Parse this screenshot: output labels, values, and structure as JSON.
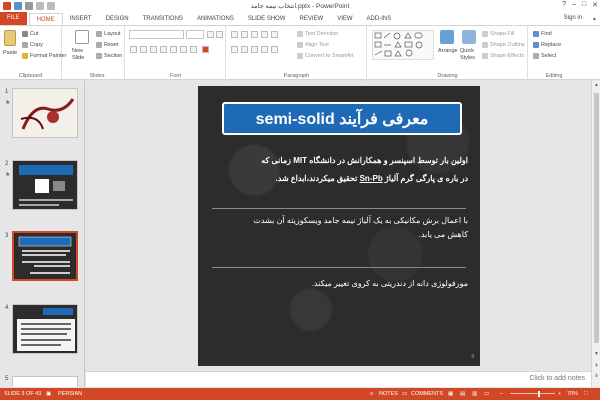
{
  "window": {
    "title": "انتخاب نيمه جامد.pptx - PowerPoint",
    "help": "?",
    "controls": [
      "–",
      "□",
      "✕"
    ],
    "signin": "Sign in"
  },
  "tabs": [
    "FILE",
    "HOME",
    "INSERT",
    "DESIGN",
    "TRANSITIONS",
    "ANIMATIONS",
    "SLIDE SHOW",
    "REVIEW",
    "VIEW",
    "ADD-INS"
  ],
  "ribbon": {
    "clipboard": {
      "label": "Clipboard",
      "paste": "Paste",
      "cut": "Cut",
      "copy": "Copy",
      "format_painter": "Format Painter"
    },
    "slides": {
      "label": "Slides",
      "new_slide": "New Slide",
      "layout": "Layout",
      "reset": "Reset",
      "section": "Section"
    },
    "font": {
      "label": "Font"
    },
    "paragraph": {
      "label": "Paragraph",
      "text_direction": "Text Direction",
      "align_text": "Align Text",
      "smartart": "Convert to SmartArt"
    },
    "drawing": {
      "label": "Drawing",
      "arrange": "Arrange",
      "quick_styles": "Quick Styles",
      "shape_fill": "Shape Fill",
      "shape_outline": "Shape Outline",
      "shape_effects": "Shape Effects"
    },
    "editing": {
      "label": "Editing",
      "find": "Find",
      "replace": "Replace",
      "select": "Select"
    }
  },
  "thumbnails": [
    {
      "num": "1"
    },
    {
      "num": "2"
    },
    {
      "num": "3"
    },
    {
      "num": "4"
    },
    {
      "num": "5"
    }
  ],
  "slide": {
    "title": "معرفی فرآیند semi-solid",
    "bullet1_line1": "اولین بار توسط اسپنسر و همکارانش در دانشگاه MIT زمانی که",
    "bullet1_line2_pre": "در باره ی پارگی گرم آلیاژ ",
    "bullet1_line2_link": "Sn-Pb",
    "bullet1_line2_post": " تحقیق میکردند،ابداع شد.",
    "bullet2_line1": "با اعمال برش مکانیکی به یک آلیاژ نیمه جامد ویسکوزیته آن بشدت",
    "bullet2_line2": "کاهش می یابد.",
    "bullet3": "مورفولوژی دانه از دندریتی به کروی تغییر میکند.",
    "number": "3"
  },
  "notes_placeholder": "Click to add notes",
  "status": {
    "slide_of": "SLIDE 3 OF 43",
    "language": "PERSIAN",
    "notes": "NOTES",
    "comments": "COMMENTS",
    "zoom": "70%"
  },
  "colors": {
    "accent": "#d24726",
    "title_box": "#1f6ab6"
  }
}
